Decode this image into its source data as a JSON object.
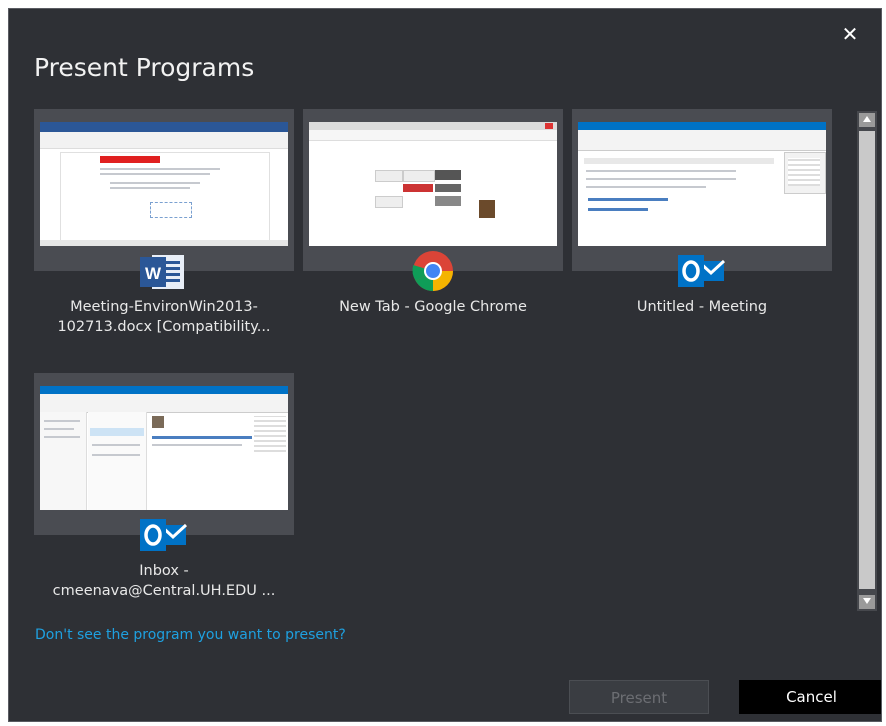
{
  "dialog": {
    "title": "Present Programs",
    "close_glyph": "✕",
    "help_link": "Don't see the program you want to present?",
    "present_label": "Present",
    "cancel_label": "Cancel"
  },
  "programs": [
    {
      "line1": "Meeting-EnvironWin2013-",
      "line2": "102713.docx [Compatibility...",
      "icon": "word-icon"
    },
    {
      "line1": "New Tab - Google Chrome",
      "line2": "",
      "icon": "chrome-icon"
    },
    {
      "line1": "Untitled - Meeting",
      "line2": "",
      "icon": "outlook-icon"
    },
    {
      "line1": "Inbox -",
      "line2": "cmeenava@Central.UH.EDU ...",
      "icon": "outlook-icon"
    }
  ],
  "colors": {
    "background": "#2e3035",
    "tile": "#4a4c52",
    "link": "#1ea0e0",
    "word": "#2b5797",
    "outlook": "#0072c6"
  }
}
